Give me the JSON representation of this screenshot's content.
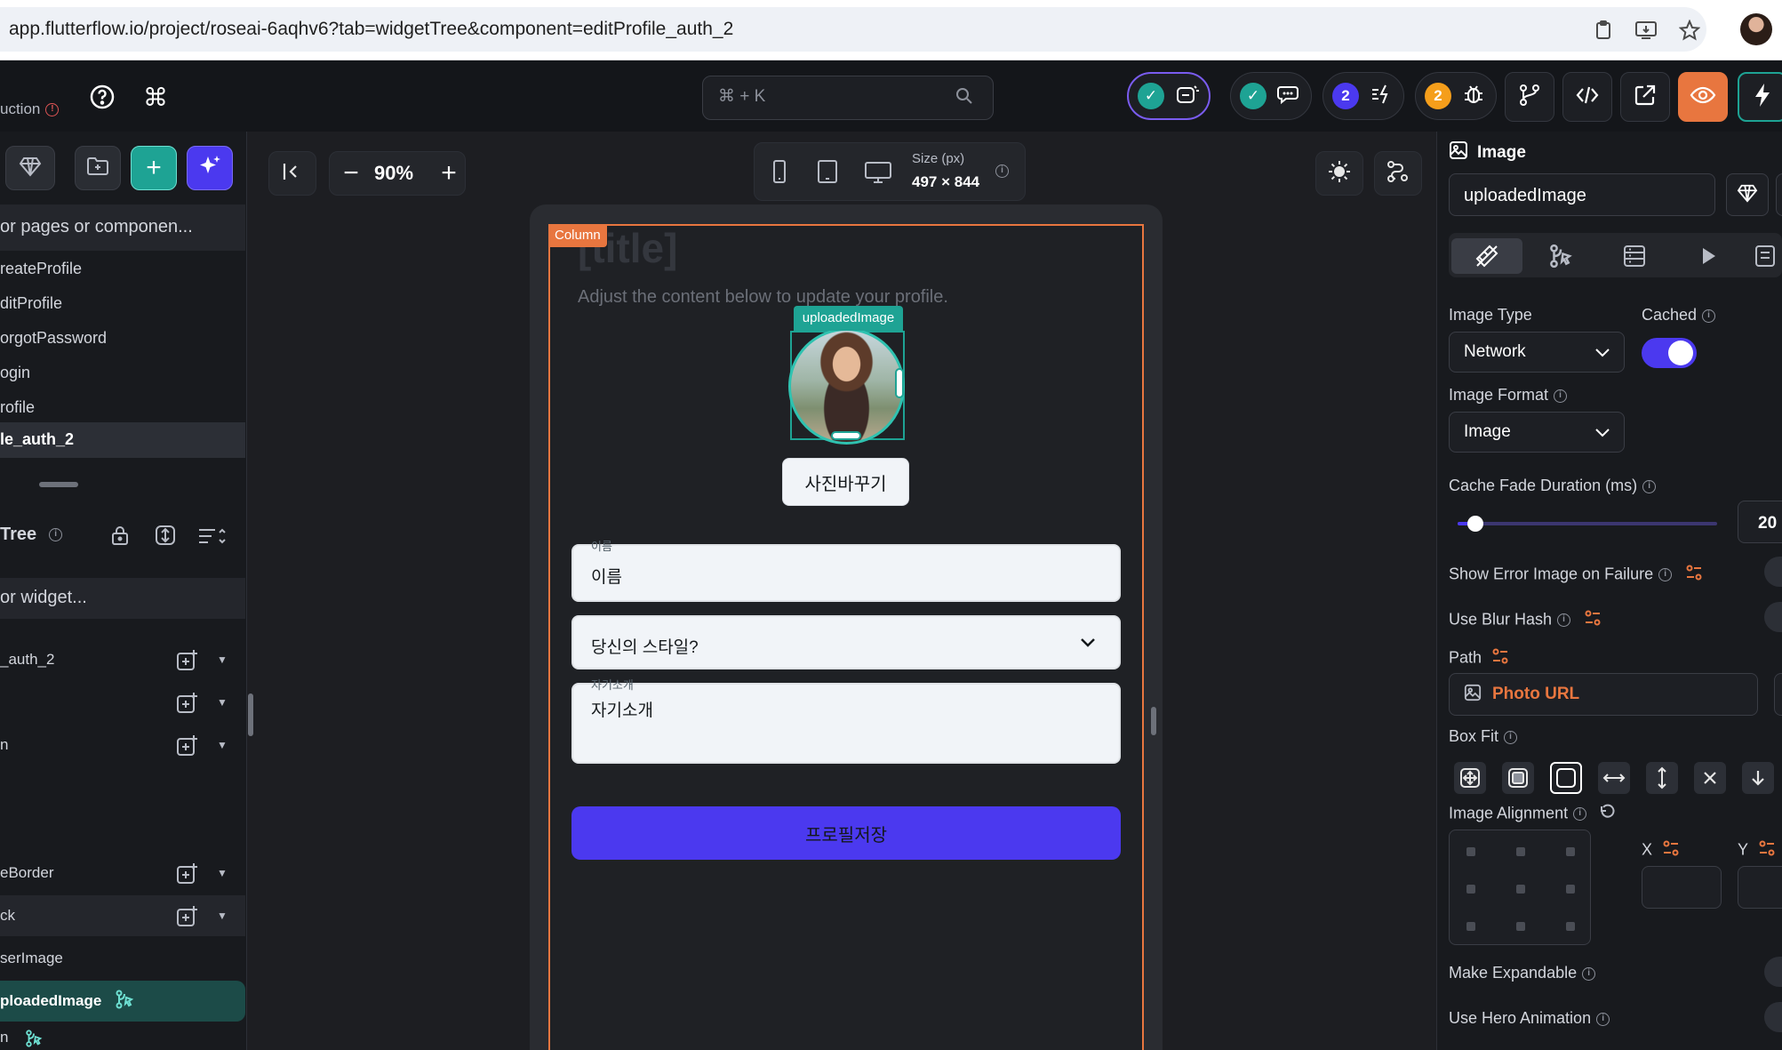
{
  "browser": {
    "url": "app.flutterflow.io/project/roseai-6aqhv6?tab=widgetTree&component=editProfile_auth_2"
  },
  "toolbar": {
    "env_label": "uction",
    "search_placeholder": "⌘ + K",
    "badge_count_1": "2",
    "badge_count_2": "2",
    "colors": {
      "teal": "#1ea394",
      "purple": "#4b39ef",
      "orange": "#f59e1b",
      "preview_bg": "#e8763f"
    }
  },
  "left_panel": {
    "search_pages_placeholder": "or pages or componen...",
    "pages": [
      "reateProfile",
      "ditProfile",
      "orgotPassword",
      "ogin",
      "rofile",
      "le_auth_2"
    ],
    "selected_page_index": 5,
    "tree_title": "Tree",
    "search_widget_placeholder": "or widget...",
    "tree_items": [
      {
        "label": "_auth_2",
        "has_add": true
      },
      {
        "label": "",
        "has_add": true
      },
      {
        "label": "n",
        "has_add": true
      },
      {
        "label": "eBorder",
        "has_add": true
      },
      {
        "label": "ck",
        "has_add": true
      },
      {
        "label": "serImage",
        "has_add": false
      },
      {
        "label": "ploadedImage",
        "has_add": false
      },
      {
        "label": "n",
        "has_add": false
      }
    ]
  },
  "canvas": {
    "zoom": "90%",
    "size_label": "Size (px)",
    "size_value": "497 × 844",
    "column_tag": "Column",
    "title": "[title]",
    "subtitle": "Adjust the content below to update your profile.",
    "image_tag": "uploadedImage",
    "change_photo_button": "사진바꾸기",
    "name_label": "이름",
    "name_value": "이름",
    "style_dropdown": "당신의 스타일?",
    "bio_label": "자기소개",
    "bio_value": "자기소개",
    "save_button": "프로필저장"
  },
  "right_panel": {
    "widget_type": "Image",
    "widget_name": "uploadedImage",
    "image_type_label": "Image Type",
    "image_type_value": "Network",
    "cached_label": "Cached",
    "cached": true,
    "image_format_label": "Image Format",
    "image_format_value": "Image",
    "cache_fade_label": "Cache Fade Duration (ms)",
    "cache_fade_value": "20",
    "show_error_label": "Show Error Image on Failure",
    "use_blur_label": "Use Blur Hash",
    "path_label": "Path",
    "path_value": "Photo URL",
    "box_fit_label": "Box Fit",
    "image_alignment_label": "Image Alignment",
    "x_label": "X",
    "y_label": "Y",
    "make_expandable_label": "Make Expandable",
    "hero_animation_label": "Use Hero Animation"
  }
}
